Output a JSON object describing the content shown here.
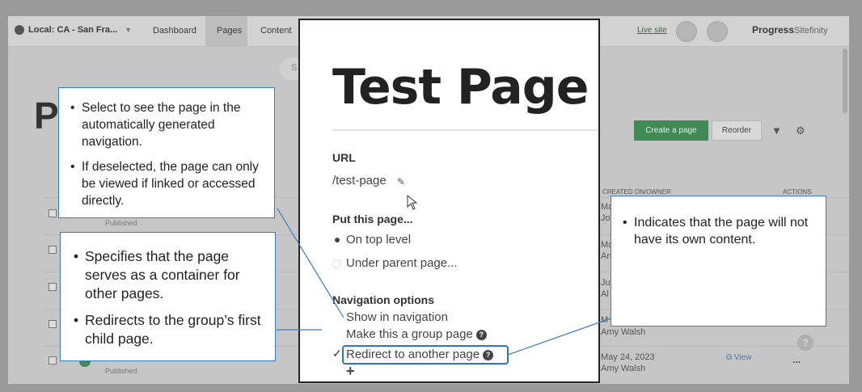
{
  "app": {
    "site_selector": "Local: CA - San Fra...",
    "nav": [
      "Dashboard",
      "Pages",
      "Content"
    ],
    "live_site": "Live site",
    "brand_bold": "Progress",
    "brand_light": "Sitefinity",
    "page_heading": "P",
    "search_stub": "S",
    "create_button": "Create a page",
    "reorder_button": "Reorder",
    "col_created": "CREATED ON/OWNER",
    "col_actions": "ACTIONS",
    "rows": [
      {
        "status": "Published",
        "created": "Ma",
        "owner": "Jo"
      },
      {
        "status": "",
        "created": "Ma",
        "owner": "An"
      },
      {
        "status": "",
        "created": "Ju",
        "owner": "Al"
      },
      {
        "status": "",
        "created": "M",
        "owner": "Amy Walsh"
      },
      {
        "status": "Published",
        "created": "May 24, 2023",
        "owner": "Amy Walsh",
        "view": "View",
        "menu": "..."
      }
    ],
    "help": "?"
  },
  "zoom": {
    "title": "Test Page",
    "url_label": "URL",
    "url_value": "/test-page",
    "put_label": "Put this page...",
    "on_top_level": "On top level",
    "under_parent": "Under parent page...",
    "nav_label": "Navigation options",
    "show_in_nav": "Show in navigation",
    "make_group": "Make this a group page",
    "redirect": "Redirect to another page"
  },
  "callouts": {
    "top_left": [
      "Select to see the page in the automatically generated navigation.",
      "If deselected, the page can only be viewed if linked or accessed directly."
    ],
    "bottom_left": [
      "Specifies that the page serves as a container for other pages.",
      "Redirects to the group’s first child page."
    ],
    "right": [
      "Indicates that the page will not have its own content."
    ]
  }
}
